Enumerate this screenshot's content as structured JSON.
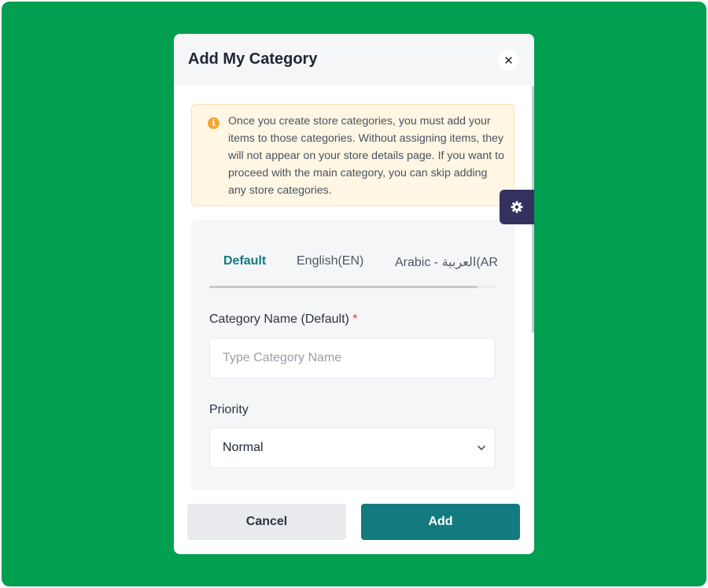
{
  "colors": {
    "backdrop": "#019f4f",
    "accent": "#137a7f",
    "notice_bg": "#fff6e3",
    "info_icon": "#f1a83b",
    "required": "#e53935",
    "settings_bg": "#343160"
  },
  "modal": {
    "title": "Add My Category",
    "close_icon": "close-icon",
    "close_glyph": "✕"
  },
  "notice": {
    "icon": "info-icon",
    "icon_glyph": "i",
    "text": "Once you create store categories, you must add your items to those categories. Without assigning items, they will not appear on your store details page. If you want to proceed with the main category, you can skip adding any store categories."
  },
  "tabs": [
    {
      "label": "Default",
      "active": true
    },
    {
      "label": "English(EN)",
      "active": false
    },
    {
      "label": "Arabic - العربية(AR",
      "active": false
    }
  ],
  "form": {
    "category_name": {
      "label": "Category Name (Default)",
      "required_mark": "*",
      "value": "",
      "placeholder": "Type Category Name"
    },
    "priority": {
      "label": "Priority",
      "selected": "Normal",
      "icon": "chevron-down-icon"
    }
  },
  "footer": {
    "cancel_label": "Cancel",
    "add_label": "Add"
  },
  "settings_tab": {
    "icon": "gear-icon"
  }
}
